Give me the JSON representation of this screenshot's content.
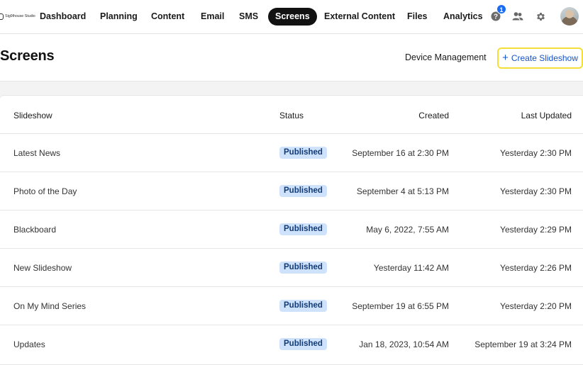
{
  "brand": {
    "logo_text": "Sig9lhouse Studio"
  },
  "nav": {
    "items": [
      {
        "label": "Dashboard"
      },
      {
        "label": "Planning"
      },
      {
        "label": "Content"
      },
      {
        "label": "Email"
      },
      {
        "label": "SMS"
      },
      {
        "label": "Screens"
      },
      {
        "label": "External Content"
      },
      {
        "label": "Files"
      },
      {
        "label": "Analytics"
      }
    ],
    "active": "Screens",
    "help_badge_count": "1",
    "icons": [
      "help-icon",
      "users-icon",
      "gear-icon",
      "avatar"
    ]
  },
  "header": {
    "title": "Screens",
    "device_management_label": "Device Management",
    "create_button_label": "Create Slideshow",
    "create_button_icon": "+"
  },
  "table": {
    "columns": {
      "slideshow": "Slideshow",
      "status": "Status",
      "created": "Created",
      "last_updated": "Last Updated"
    },
    "rows": [
      {
        "name": "Latest News",
        "status": "Published",
        "created": "September 16 at 2:30 PM",
        "updated": "Yesterday 2:30 PM"
      },
      {
        "name": "Photo of the Day",
        "status": "Published",
        "created": "September 4 at 5:13 PM",
        "updated": "Yesterday 2:30 PM"
      },
      {
        "name": "Blackboard",
        "status": "Published",
        "created": "May 6, 2022, 7:55 AM",
        "updated": "Yesterday 2:29 PM"
      },
      {
        "name": "New Slideshow",
        "status": "Published",
        "created": "Yesterday 11:42 AM",
        "updated": "Yesterday 2:26 PM"
      },
      {
        "name": "On My Mind Series",
        "status": "Published",
        "created": "September 19 at 6:55 PM",
        "updated": "Yesterday 2:20 PM"
      },
      {
        "name": "Updates",
        "status": "Published",
        "created": "Jan 18, 2023, 10:54 AM",
        "updated": "September 19 at 3:24 PM"
      }
    ]
  },
  "colors": {
    "nav_active_bg": "#121212",
    "accent_link": "#1553c8",
    "highlight_border": "#f4de3a",
    "badge_bg": "#cfe2fb",
    "badge_text": "#113a78",
    "notification_badge": "#1b6cf2"
  }
}
